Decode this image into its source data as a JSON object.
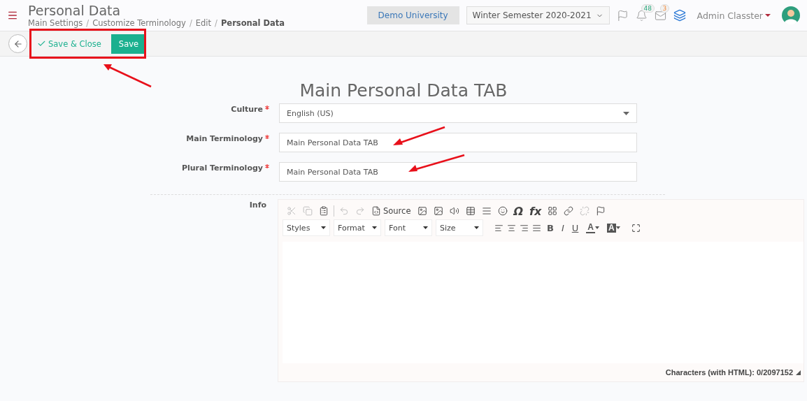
{
  "page": {
    "title": "Personal Data"
  },
  "breadcrumb_separator": "/",
  "breadcrumbs": [
    {
      "label": "Main Settings",
      "current": false
    },
    {
      "label": "Customize Terminology",
      "current": false
    },
    {
      "label": "Edit",
      "current": false
    },
    {
      "label": "Personal Data",
      "current": true
    }
  ],
  "header": {
    "institution": "Demo University",
    "semester": "Winter Semester 2020-2021",
    "notifications": "48",
    "messages": "3",
    "user": "Admin Classter"
  },
  "actions": {
    "save_close": "Save & Close",
    "save": "Save"
  },
  "form": {
    "heading": "Main Personal Data TAB",
    "fields": [
      {
        "label": "Culture",
        "kind": "select",
        "value": "English (US)",
        "required": true
      },
      {
        "label": "Main Terminology",
        "kind": "text",
        "value": "Main Personal Data TAB",
        "required": true
      },
      {
        "label": "Plural Terminology",
        "kind": "text",
        "value": "Main Personal Data TAB",
        "required": true
      }
    ],
    "info_label": "Info"
  },
  "editor": {
    "toolbar": [
      {
        "kind": "cut",
        "disabled": true
      },
      {
        "kind": "copy",
        "disabled": true
      },
      {
        "kind": "paste",
        "disabled": false
      },
      {
        "kind": "sep"
      },
      {
        "kind": "undo",
        "disabled": true
      },
      {
        "kind": "redo",
        "disabled": true
      },
      {
        "kind": "source",
        "label": "Source",
        "disabled": false
      },
      {
        "kind": "image",
        "disabled": false
      },
      {
        "kind": "image",
        "disabled": false
      },
      {
        "kind": "audio",
        "disabled": false
      },
      {
        "kind": "table",
        "disabled": false
      },
      {
        "kind": "rule",
        "disabled": false
      },
      {
        "kind": "smiley",
        "disabled": false
      },
      {
        "kind": "glyph",
        "label": "Ω",
        "disabled": false
      },
      {
        "kind": "glyph",
        "label": "fx",
        "disabled": false
      },
      {
        "kind": "blocks",
        "disabled": false
      },
      {
        "kind": "link",
        "disabled": false
      },
      {
        "kind": "unlink",
        "disabled": true
      },
      {
        "kind": "flag",
        "disabled": false
      }
    ],
    "dropdowns": [
      "Styles",
      "Format",
      "Font",
      "Size"
    ],
    "format_buttons": [
      {
        "kind": "align-left"
      },
      {
        "kind": "align-center"
      },
      {
        "kind": "align-right"
      },
      {
        "kind": "align-justify"
      },
      {
        "kind": "letter",
        "label": "B"
      },
      {
        "kind": "letter",
        "label": "I"
      },
      {
        "kind": "letter",
        "label": "U"
      },
      {
        "kind": "color",
        "label": "A"
      },
      {
        "kind": "bgcolor",
        "label": "A"
      },
      {
        "kind": "maximize"
      }
    ],
    "counter": "Characters (with HTML): 0/2097152"
  }
}
